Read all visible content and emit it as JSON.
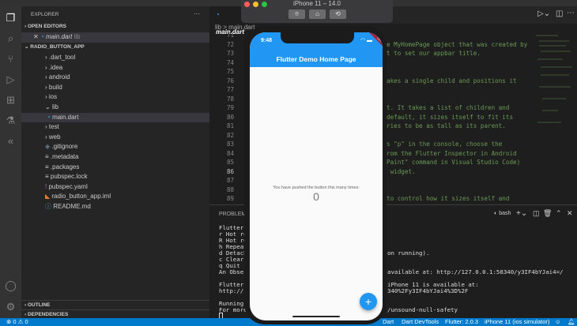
{
  "sidebar": {
    "title": "EXPLORER",
    "more": "···",
    "open_editors": "OPEN EDITORS",
    "open_file": "main.dart",
    "open_file_dir": "lib",
    "project": "RADIO_BUTTON_APP",
    "tree": [
      {
        "label": ".dart_tool",
        "kind": "folder",
        "indent": 1
      },
      {
        "label": ".idea",
        "kind": "folder",
        "indent": 1
      },
      {
        "label": "android",
        "kind": "folder",
        "indent": 1
      },
      {
        "label": "build",
        "kind": "folder",
        "indent": 1
      },
      {
        "label": "ios",
        "kind": "folder",
        "indent": 1
      },
      {
        "label": "lib",
        "kind": "open-folder",
        "indent": 1
      },
      {
        "label": "main.dart",
        "kind": "dart",
        "indent": 2
      },
      {
        "label": "test",
        "kind": "folder",
        "indent": 1
      },
      {
        "label": "web",
        "kind": "folder",
        "indent": 1
      },
      {
        "label": ".gitignore",
        "kind": "diamond",
        "indent": 1
      },
      {
        "label": ".metadata",
        "kind": "lines",
        "indent": 1
      },
      {
        "label": ".packages",
        "kind": "lines",
        "indent": 1
      },
      {
        "label": "pubspec.lock",
        "kind": "lines",
        "indent": 1
      },
      {
        "label": "pubspec.yaml",
        "kind": "excl",
        "indent": 1
      },
      {
        "label": "radio_button_app.iml",
        "kind": "iml",
        "indent": 1
      },
      {
        "label": "README.md",
        "kind": "info",
        "indent": 1
      }
    ],
    "outline": "OUTLINE",
    "dependencies": "DEPENDENCIES"
  },
  "editor": {
    "tab": "main.dart",
    "breadcrumb": [
      "lib",
      ">",
      "main.dart"
    ],
    "line_numbers": [
      "71",
      "72",
      "73",
      "74",
      "75",
      "76",
      "77",
      "78",
      "79",
      "80",
      "81",
      "82",
      "83",
      "84",
      "85",
      "86",
      "87",
      "88",
      "89"
    ],
    "code": [
      "",
      "e MyHomePage object that was created by",
      "t to set our appbar title.",
      "",
      "",
      "akes a single child and positions it",
      "",
      "",
      "t. It takes a list of children and",
      "default, it sizes itself to fit its",
      "ries to be as tall as its parent.",
      "",
      "s \"p\" in the console, choose the",
      "rom the Flutter Inspector in Android",
      "Paint\" command in Visual Studio Code)",
      " widget.",
      "",
      "",
      "to control how it sizes itself and"
    ]
  },
  "panel": {
    "tab": "PROBLEMS",
    "shell": "bash",
    "left_lines": [
      "Flutter",
      "r Hot re",
      "R Hot re",
      "h Repeat",
      "d Detach",
      "c Clear",
      "q Quit (",
      "An Obser",
      "",
      "Flutter",
      "http://1",
      "",
      "Running",
      "For more"
    ],
    "right_lines": [
      "",
      "",
      "",
      "",
      "on running).",
      "",
      "",
      "available at: http://127.0.0.1:58340/y3IF4bYJai4=/",
      "",
      "iPhone 11 is available at:",
      "340%2Fy3IF4bYJai4%3D%2F",
      "",
      "",
      "/unsound-null-safety"
    ]
  },
  "status": {
    "errors": "0",
    "warnings": "0",
    "items": [
      "Dart",
      "Dart DevTools",
      "Flutter: 2.0.3",
      "iPhone 11 (ios simulator)"
    ]
  },
  "simulator": {
    "title": "iPhone 11 – 14.0",
    "time": "9:48",
    "app_title": "Flutter Demo Home Page",
    "counter_label": "You have pushed the button this many times:",
    "counter": "0",
    "fab": "+",
    "debug_banner": "DEBUG"
  }
}
